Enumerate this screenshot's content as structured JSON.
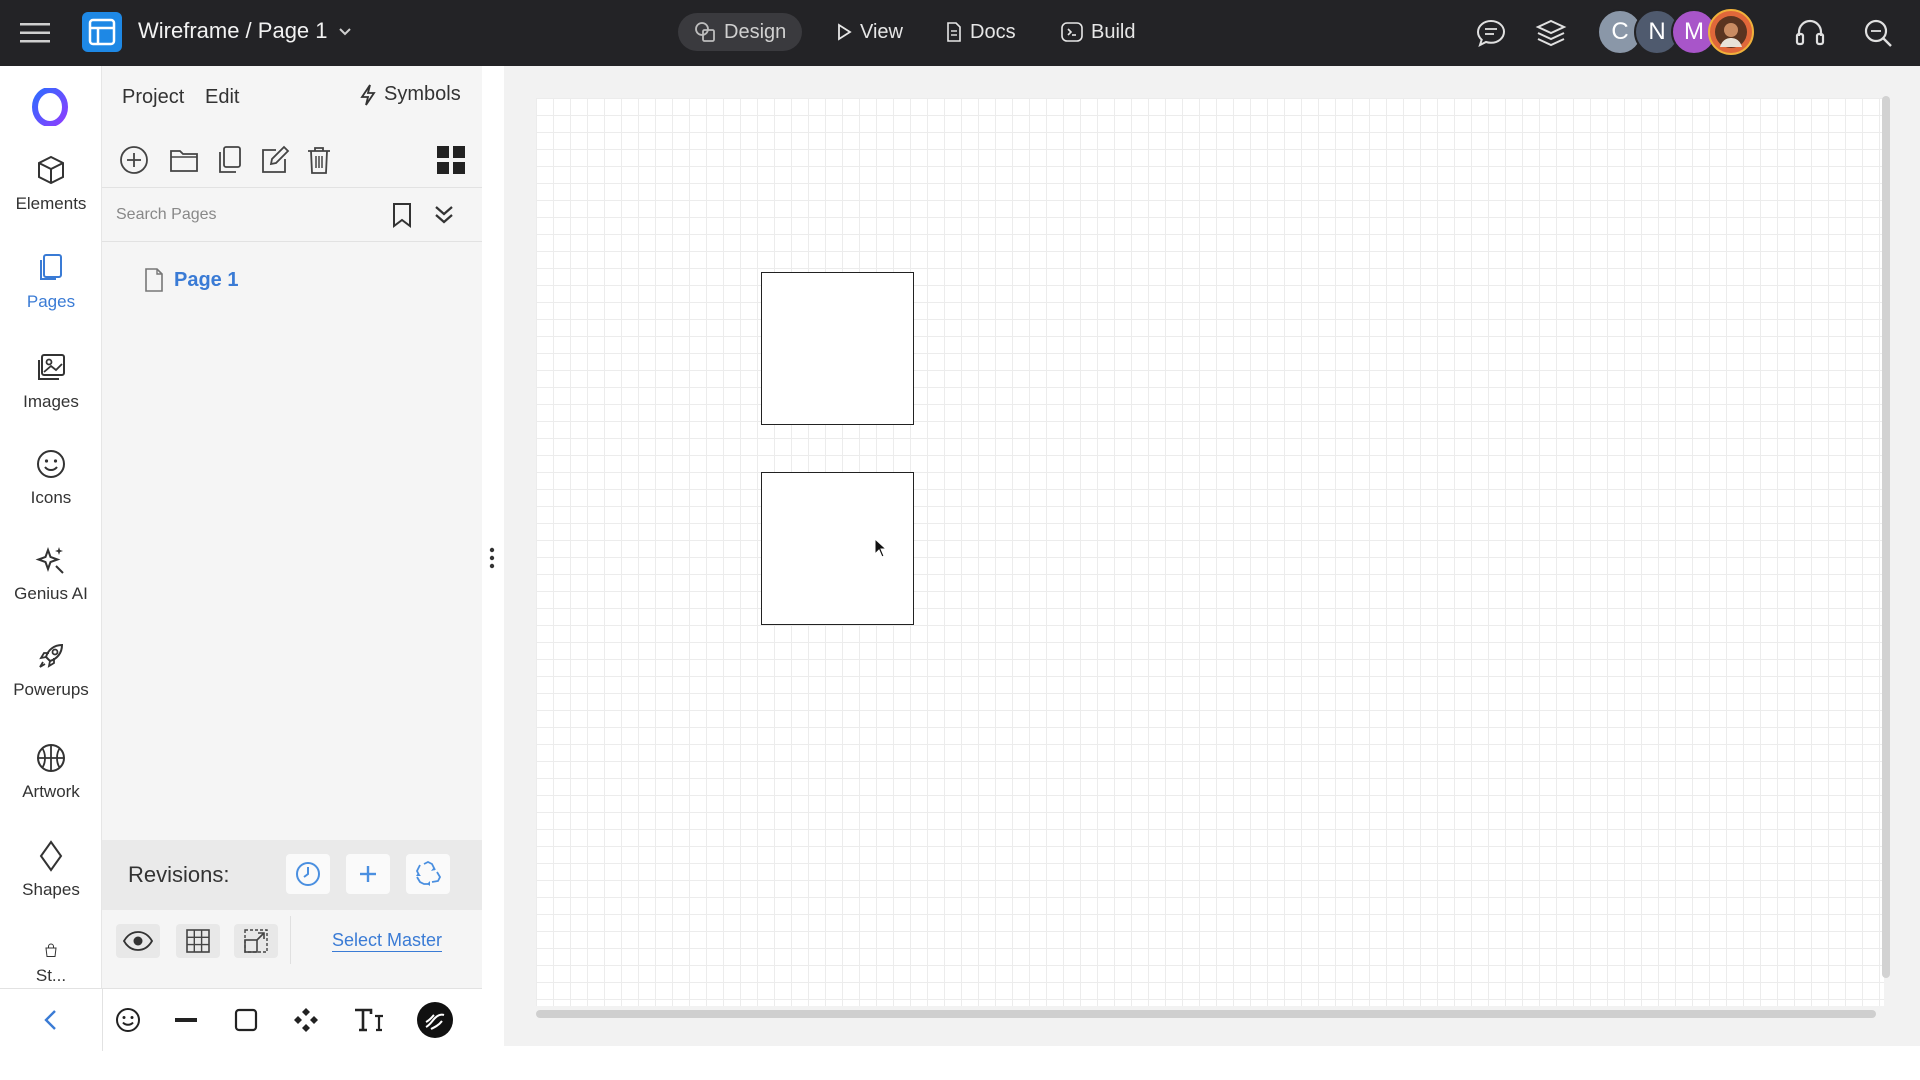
{
  "header": {
    "title": "Wireframe / Page 1",
    "nav": [
      {
        "label": "Design",
        "icon": "design-icon"
      },
      {
        "label": "View",
        "icon": "play-icon"
      },
      {
        "label": "Docs",
        "icon": "document-icon"
      },
      {
        "label": "Build",
        "icon": "build-icon"
      }
    ],
    "avatars": [
      {
        "initial": "C",
        "color": "#8a97a8"
      },
      {
        "initial": "N",
        "color": "#4f5a6e"
      },
      {
        "initial": "M",
        "color": "#a855c9"
      },
      {
        "initial": "",
        "color": "#e0673a"
      }
    ]
  },
  "rail": {
    "items": [
      {
        "label": "Elements",
        "icon": "cube-icon"
      },
      {
        "label": "Pages",
        "icon": "pages-icon",
        "active": true
      },
      {
        "label": "Images",
        "icon": "image-icon"
      },
      {
        "label": "Icons",
        "icon": "smiley-icon"
      },
      {
        "label": "Genius AI",
        "icon": "sparkle-icon"
      },
      {
        "label": "Powerups",
        "icon": "rocket-icon"
      },
      {
        "label": "Artwork",
        "icon": "basketball-icon"
      },
      {
        "label": "Shapes",
        "icon": "diamond-icon"
      },
      {
        "label": "St...",
        "icon": "bag-icon"
      }
    ]
  },
  "panel": {
    "menu": {
      "project": "Project",
      "edit": "Edit",
      "symbols": "Symbols"
    },
    "search": {
      "placeholder": "Search Pages"
    },
    "pages": [
      {
        "label": "Page 1"
      }
    ],
    "revisions": {
      "label": "Revisions:"
    },
    "select_master": "Select Master"
  },
  "colors": {
    "topbar": "#232326",
    "accent": "#3a7bd5",
    "panel_bg": "#f5f5f5",
    "canvas_bg": "#f2f2f2"
  }
}
